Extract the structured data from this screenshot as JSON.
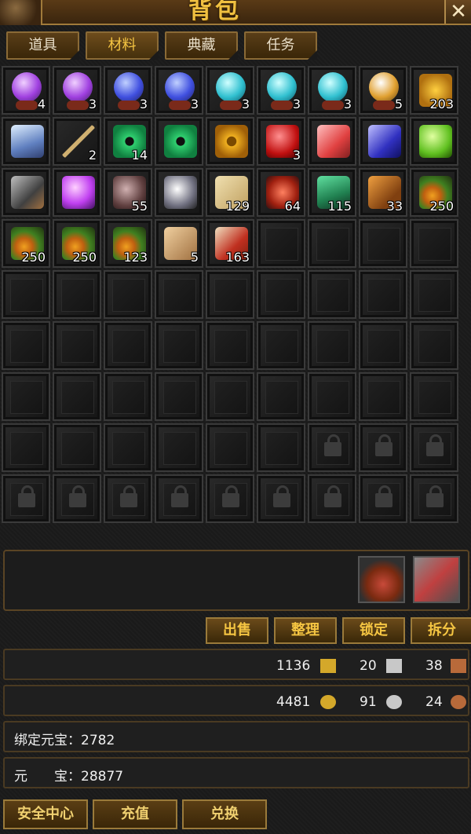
{
  "header": {
    "title": "背包",
    "close_label": "✕"
  },
  "tabs": [
    {
      "label": "道具",
      "active": false
    },
    {
      "label": "材料",
      "active": true
    },
    {
      "label": "典藏",
      "active": false
    },
    {
      "label": "任务",
      "active": false
    }
  ],
  "items": [
    {
      "icon": "purple-crystal-ball-icon",
      "count": "4"
    },
    {
      "icon": "purple-crystal-ball-icon",
      "count": "3"
    },
    {
      "icon": "blue-crystal-ball-icon",
      "count": "3"
    },
    {
      "icon": "blue-crystal-ball-icon",
      "count": "3"
    },
    {
      "icon": "cyan-crystal-ball-icon",
      "count": "3"
    },
    {
      "icon": "cyan-crystal-ball-icon",
      "count": "3"
    },
    {
      "icon": "cyan-crystal-ball-icon",
      "count": "3"
    },
    {
      "icon": "gold-crystal-ball-icon",
      "count": "5"
    },
    {
      "icon": "gold-ingot-icon",
      "count": "203"
    },
    {
      "icon": "snow-mountain-icon",
      "count": ""
    },
    {
      "icon": "arrow-icon",
      "count": "2"
    },
    {
      "icon": "jade-disc-icon",
      "count": "14"
    },
    {
      "icon": "jade-disc-icon",
      "count": ""
    },
    {
      "icon": "gold-coin-icon",
      "count": ""
    },
    {
      "icon": "red-gem-icon",
      "count": "3"
    },
    {
      "icon": "pink-crystal-icon",
      "count": ""
    },
    {
      "icon": "blue-gem-icon",
      "count": ""
    },
    {
      "icon": "green-gem-icon",
      "count": ""
    },
    {
      "icon": "hexagon-stone-icon",
      "count": ""
    },
    {
      "icon": "purple-orb-icon",
      "count": ""
    },
    {
      "icon": "ore-rock-icon",
      "count": "55"
    },
    {
      "icon": "silver-ore-icon",
      "count": ""
    },
    {
      "icon": "scroll-paper-icon",
      "count": "129"
    },
    {
      "icon": "fish-icon",
      "count": "64"
    },
    {
      "icon": "green-snake-icon",
      "count": "115"
    },
    {
      "icon": "centipede-icon",
      "count": "33"
    },
    {
      "icon": "fruit-branch-icon",
      "count": "250"
    },
    {
      "icon": "fruit-branch-icon",
      "count": "250"
    },
    {
      "icon": "fruit-branch-icon",
      "count": "250"
    },
    {
      "icon": "fruit-branch-icon",
      "count": "123"
    },
    {
      "icon": "bone-fragment-icon",
      "count": "5"
    },
    {
      "icon": "talisman-icon",
      "count": "163"
    }
  ],
  "grid": {
    "total_slots": 81,
    "locked_from": 69
  },
  "side_icons": [
    "treasure-bag-icon",
    "treasure-chest-icon"
  ],
  "actions": {
    "sell": "出售",
    "sort": "整理",
    "lock": "锁定",
    "split": "拆分"
  },
  "currency_row1": [
    {
      "value": "1136",
      "icon": "gold-book-icon",
      "color": "#d4a82a"
    },
    {
      "value": "20",
      "icon": "silver-book-icon",
      "color": "#c8c8c8"
    },
    {
      "value": "38",
      "icon": "bronze-book-icon",
      "color": "#b86a3a"
    }
  ],
  "currency_row2": [
    {
      "value": "4481",
      "icon": "gold-coin-icon",
      "color": "#d4a82a"
    },
    {
      "value": "91",
      "icon": "silver-coin-icon",
      "color": "#c8c8c8"
    },
    {
      "value": "24",
      "icon": "bronze-coin-icon",
      "color": "#b86a3a"
    }
  ],
  "bound_yuanbao": {
    "label": "绑定元宝：",
    "value": "2782"
  },
  "yuanbao": {
    "label": "元　　宝：",
    "value": "28877"
  },
  "bottom_buttons": {
    "security": "安全中心",
    "recharge": "充值",
    "exchange": "兑换"
  }
}
